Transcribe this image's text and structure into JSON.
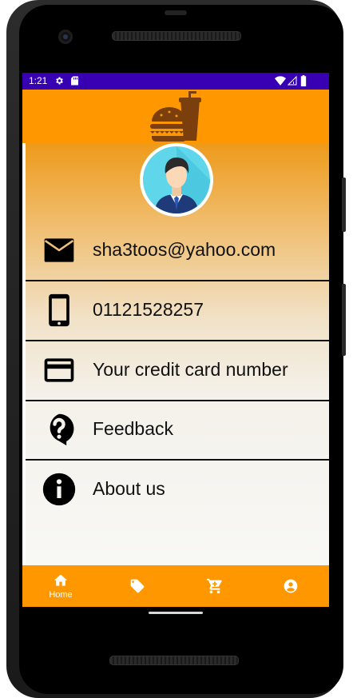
{
  "status_bar": {
    "time": "1:21",
    "icons": [
      "gear-icon",
      "sd-card-icon",
      "wifi-icon",
      "signal-icon",
      "battery-icon"
    ],
    "background": "#3700b3"
  },
  "app_bar": {
    "logo": "burger-and-drink-logo",
    "background": "#ff9800"
  },
  "profile": {
    "avatar": "man-in-suit-avatar"
  },
  "menu": {
    "items": [
      {
        "icon": "mail-icon",
        "label": "sha3toos@yahoo.com"
      },
      {
        "icon": "phone-icon",
        "label": "01121528257"
      },
      {
        "icon": "credit-card-icon",
        "label": "Your credit card number"
      },
      {
        "icon": "help-icon",
        "label": "Feedback"
      },
      {
        "icon": "info-icon",
        "label": "About us"
      }
    ]
  },
  "bottom_nav": {
    "background": "#ff9800",
    "items": [
      {
        "icon": "home-icon",
        "label": "Home",
        "selected": true
      },
      {
        "icon": "tag-icon",
        "label": ""
      },
      {
        "icon": "cart-icon",
        "label": ""
      },
      {
        "icon": "account-icon",
        "label": ""
      }
    ]
  }
}
